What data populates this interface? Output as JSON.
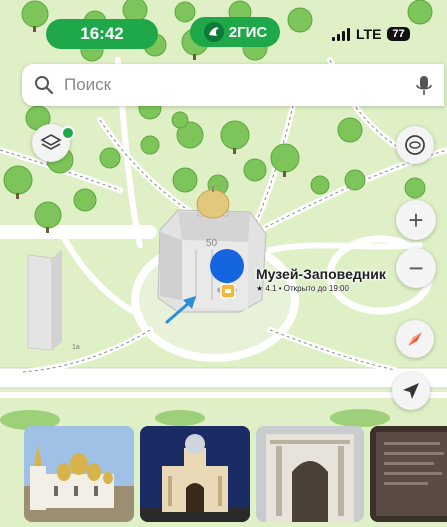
{
  "status_bar": {
    "time": "16:42",
    "brand_name": "2ГИС",
    "network": "LTE",
    "battery": "77"
  },
  "search": {
    "placeholder": "Поиск",
    "icon": "search-icon",
    "voice_icon": "microphone-icon"
  },
  "map_controls": {
    "layers_icon": "layers-icon",
    "compass_icon": "compass-icon",
    "zoom_in_label": "+",
    "zoom_out_label": "−",
    "direction_icon": "navigation-arrow-icon",
    "my_location_icon": "location-arrow-icon"
  },
  "place": {
    "name": "Музей-Заповедник",
    "rating_line": "★ 4.1 • Открыто до 19:00",
    "building_number": "50"
  },
  "map_labels": {
    "house_number": "1а"
  },
  "photos": [
    "cathedral-ensemble-photo",
    "cathedral-night-photo",
    "carved-facade-photo",
    "info-plaque-photo"
  ],
  "colors": {
    "brand_green": "#1fa84a",
    "map_background": "#dff0c6",
    "pin_blue": "#1565e0",
    "tree_green": "#7dc55a"
  }
}
